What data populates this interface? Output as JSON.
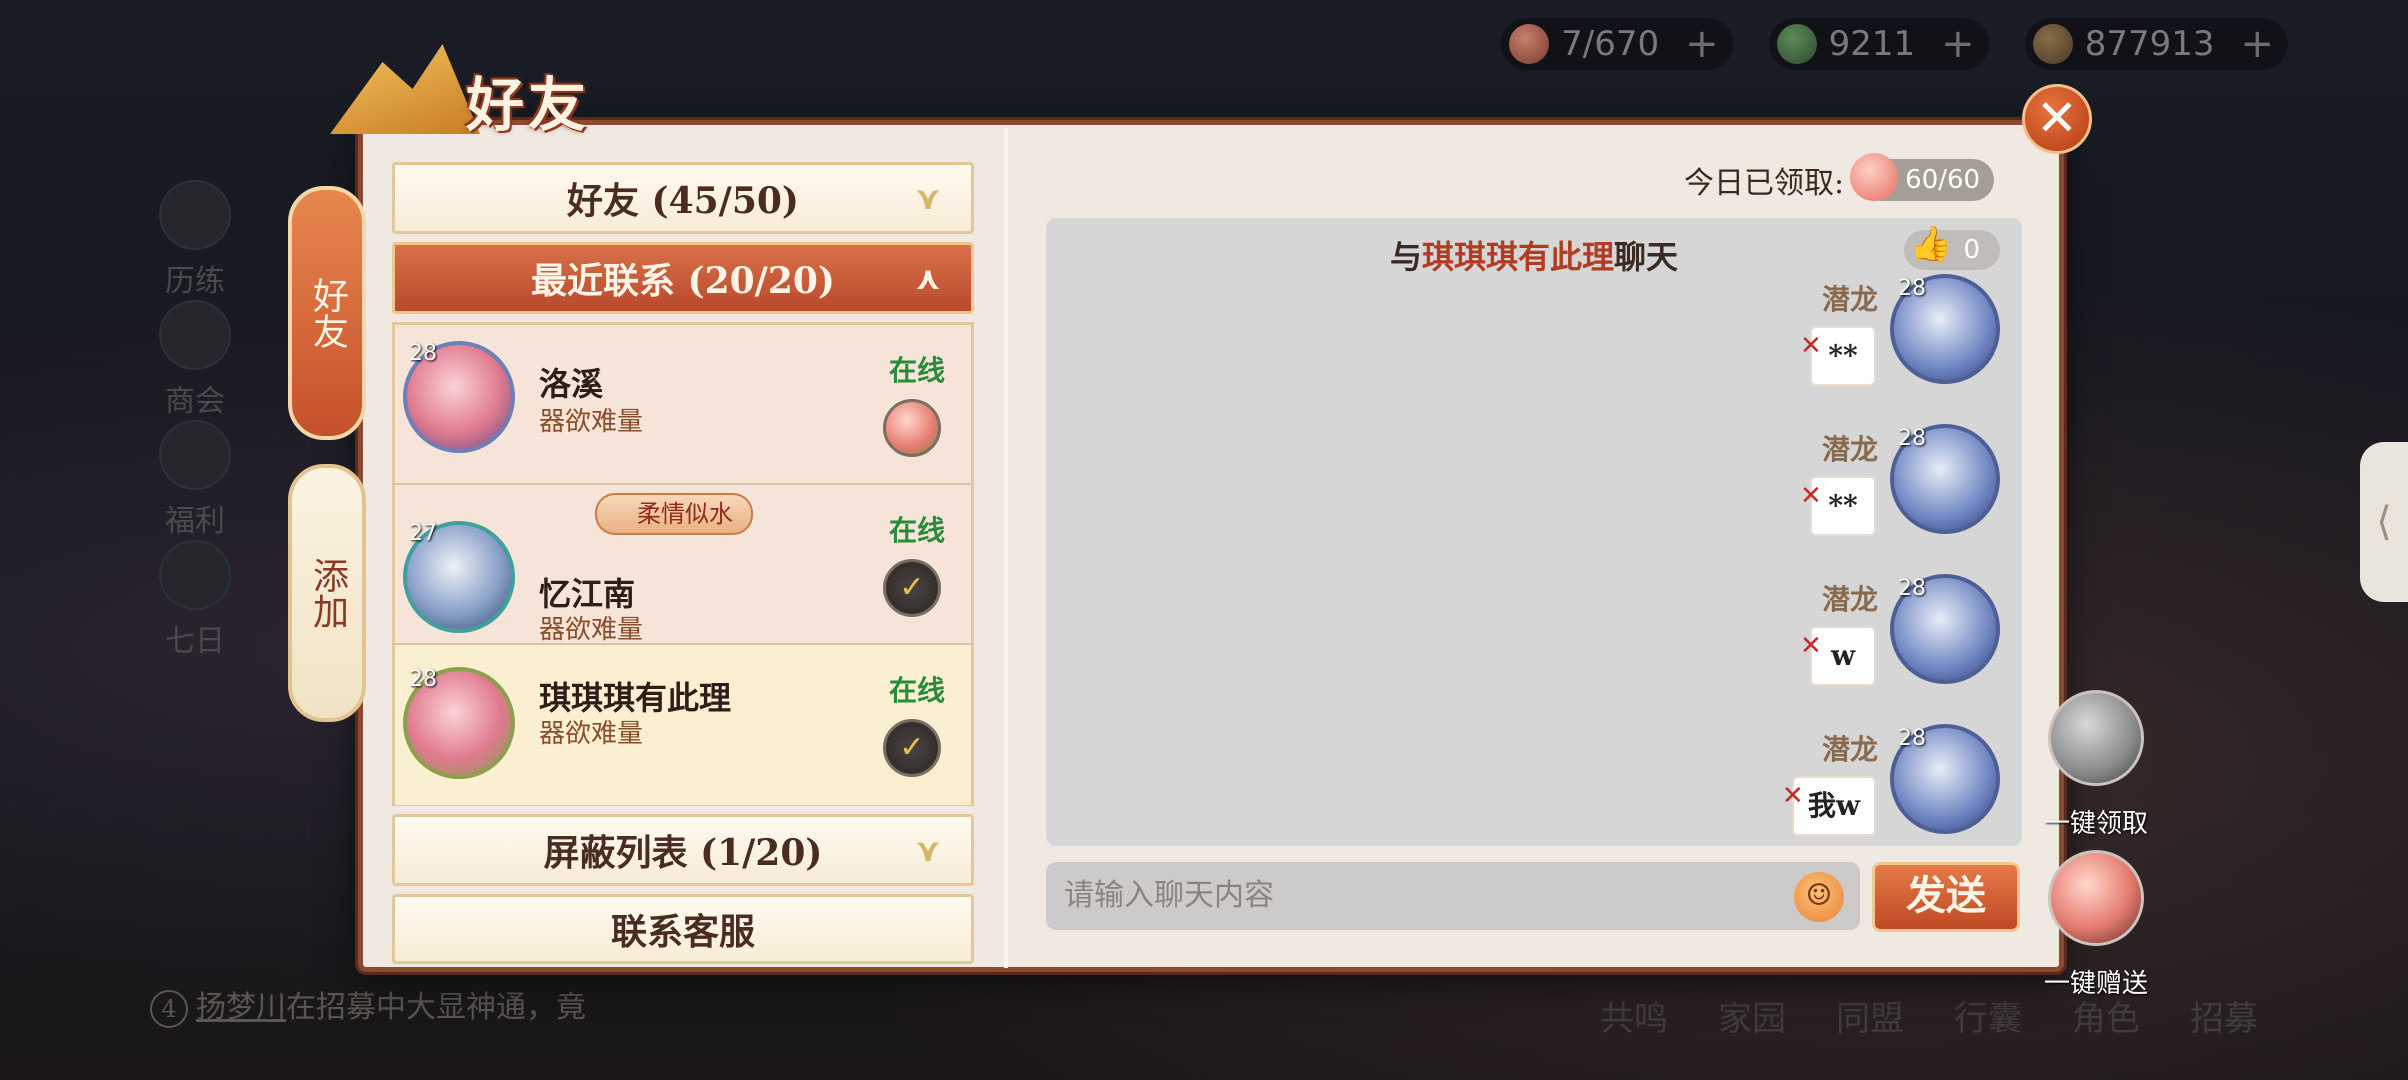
{
  "dialog": {
    "title": "好友"
  },
  "side_tabs": {
    "friends": "好友",
    "add": "添加"
  },
  "resources": [
    {
      "icon": "peach-icon",
      "value": "7/670"
    },
    {
      "icon": "jade-icon",
      "value": "9211"
    },
    {
      "icon": "coin-icon",
      "value": "877913"
    }
  ],
  "background_menu": [
    "历练",
    "商会",
    "福利",
    "七日"
  ],
  "background_bottom": [
    "共鸣",
    "家园",
    "同盟",
    "行囊",
    "角色",
    "招募"
  ],
  "ticker": {
    "num": "4",
    "name": "扬梦川",
    "text": "在招募中大显神通，竟"
  },
  "categories": {
    "friends": "好友 (45/50)",
    "recent": "最近联系 (20/20)",
    "blocked": "屏蔽列表 (1/20)",
    "service": "联系客服"
  },
  "friends": [
    {
      "level": "28",
      "name": "洛溪",
      "signature": "器欲难量",
      "status": "在线",
      "title": ""
    },
    {
      "level": "27",
      "name": "忆江南",
      "signature": "器欲难量",
      "status": "在线",
      "title": "柔情似水"
    },
    {
      "level": "28",
      "name": "琪琪琪有此理",
      "signature": "器欲难量",
      "status": "在线",
      "title": ""
    }
  ],
  "claim": {
    "label": "今日已领取:",
    "value": "60/60"
  },
  "chat": {
    "prefix": "与",
    "peer": "琪琪琪有此理",
    "suffix": "聊天",
    "likes": "0",
    "messages": [
      {
        "sender": "潜龙",
        "level": "28",
        "text": "**"
      },
      {
        "sender": "潜龙",
        "level": "28",
        "text": "**"
      },
      {
        "sender": "潜龙",
        "level": "28",
        "text": "w"
      },
      {
        "sender": "潜龙",
        "level": "28",
        "text": "我w"
      }
    ],
    "input_placeholder": "请输入聊天内容",
    "send_label": "发送"
  },
  "actions": {
    "claim_all": "一键领取",
    "send_all": "一键赠送"
  },
  "colors": {
    "accent": "#c6502a",
    "online": "#2a8c3a",
    "frame": "#8a4a32"
  }
}
